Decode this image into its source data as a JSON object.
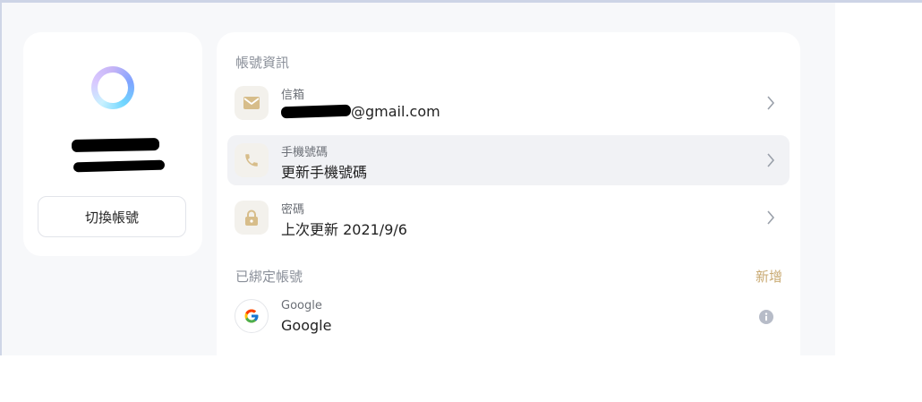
{
  "profile": {
    "switch_account_label": "切換帳號"
  },
  "account_info": {
    "section_title": "帳號資訊",
    "items": [
      {
        "label": "信箱",
        "value": "@gmail.com",
        "icon": "mail-icon"
      },
      {
        "label": "手機號碼",
        "value": "更新手機號碼",
        "icon": "phone-icon"
      },
      {
        "label": "密碼",
        "value": "上次更新 2021/9/6",
        "icon": "lock-icon"
      }
    ]
  },
  "linked_accounts": {
    "section_title": "已綁定帳號",
    "add_label": "新增",
    "items": [
      {
        "label": "Google",
        "value": "Google",
        "icon": "google-icon"
      }
    ]
  },
  "colors": {
    "accent": "#c9aa73",
    "page_background": "#f7f8fa",
    "highlight_row": "#f1f2f5"
  }
}
